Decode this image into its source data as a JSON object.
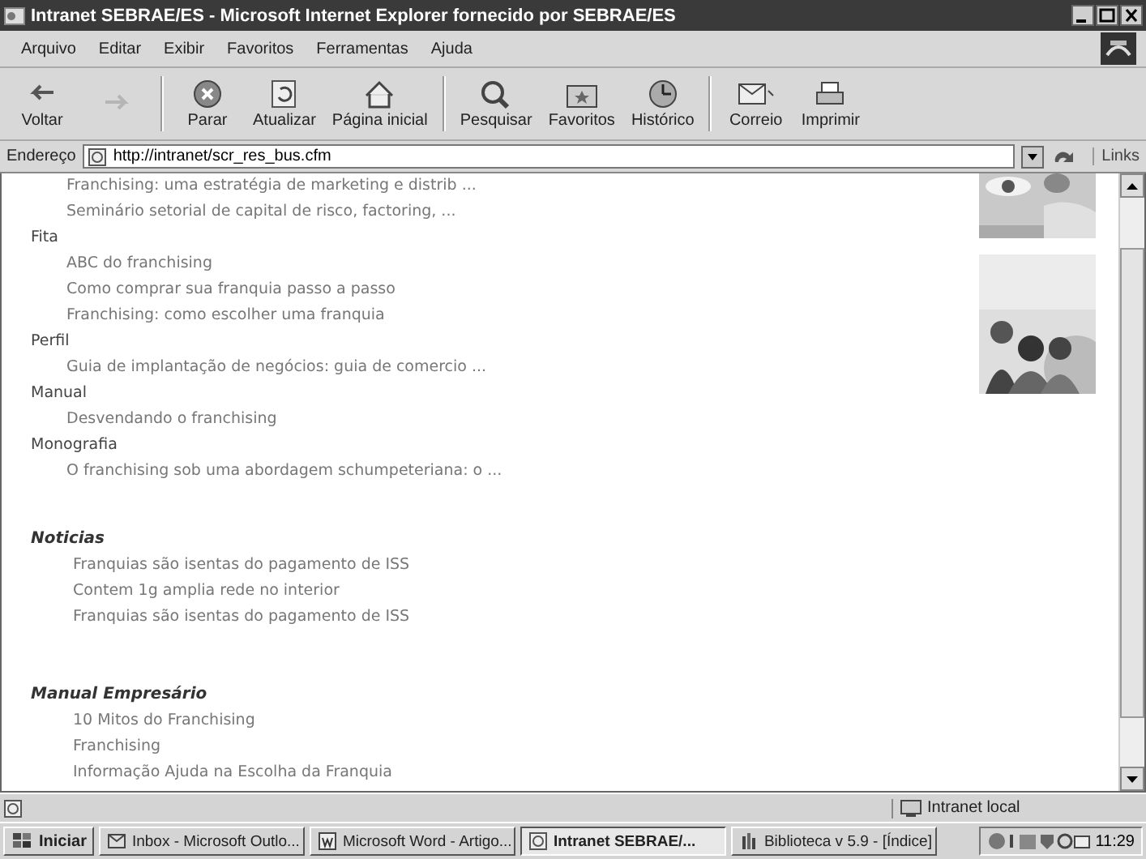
{
  "window": {
    "title": "Intranet SEBRAE/ES - Microsoft Internet Explorer fornecido por SEBRAE/ES"
  },
  "menu": [
    "Arquivo",
    "Editar",
    "Exibir",
    "Favoritos",
    "Ferramentas",
    "Ajuda"
  ],
  "toolbar": {
    "buttons": [
      {
        "label": "Voltar",
        "disabled": false
      },
      {
        "disabled": true
      },
      {
        "label": "Parar",
        "disabled": false
      },
      {
        "label": "Atualizar",
        "disabled": false
      },
      {
        "label": "Página inicial",
        "disabled": false
      },
      {
        "label": "Pesquisar",
        "disabled": false
      },
      {
        "label": "Favoritos",
        "disabled": false
      },
      {
        "label": "Histórico",
        "disabled": false
      },
      {
        "label": "Correio",
        "disabled": false
      },
      {
        "label": "Imprimir",
        "disabled": false
      }
    ]
  },
  "address": {
    "label": "Endereço",
    "value": "http://intranet/scr_res_bus.cfm",
    "links": "Links"
  },
  "content": {
    "groups": [
      {
        "kind": "category",
        "items": [
          "Franchising: uma estratégia de marketing e distrib ...",
          "Seminário setorial de capital de risco, factoring, ..."
        ]
      },
      {
        "kind": "category",
        "heading": "Fita",
        "items": [
          "ABC do franchising",
          "Como comprar sua franquia passo a passo",
          "Franchising: como escolher uma franquia"
        ]
      },
      {
        "kind": "category",
        "heading": "Perfil",
        "items": [
          "Guia de implantação de negócios: guia de comercio ..."
        ]
      },
      {
        "kind": "category",
        "heading": "Manual",
        "items": [
          "Desvendando o franchising"
        ]
      },
      {
        "kind": "category",
        "heading": "Monografia",
        "items": [
          "O franchising sob uma abordagem schumpeteriana: o ..."
        ]
      },
      {
        "kind": "section",
        "heading": "Noticias",
        "items": [
          "Franquias são isentas do pagamento de ISS",
          "Contem 1g amplia rede no interior",
          "Franquias são isentas do pagamento de ISS"
        ]
      },
      {
        "kind": "section",
        "heading": "Manual Empresário",
        "items": [
          "10 Mitos do Franchising",
          "Franchising",
          "Informação Ajuda na Escolha da Franquia"
        ]
      }
    ]
  },
  "status_bar": {
    "zone": "Intranet local"
  },
  "taskbar": {
    "start": "Iniciar",
    "tasks": [
      {
        "label": "Inbox - Microsoft Outlo...",
        "selected": false
      },
      {
        "label": "Microsoft Word - Artigo...",
        "selected": false
      },
      {
        "label": "Intranet SEBRAE/...",
        "selected": true
      },
      {
        "label": "Biblioteca v 5.9 - [Índice]",
        "selected": false
      }
    ],
    "clock": "11:29"
  }
}
